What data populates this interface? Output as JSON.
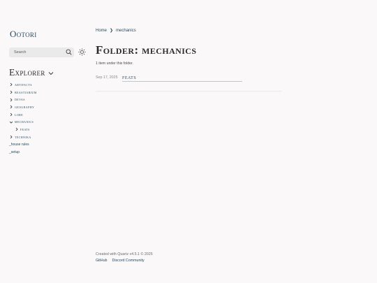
{
  "site": {
    "title": "Ootori"
  },
  "search": {
    "placeholder": "Search"
  },
  "explorer": {
    "title": "Explorer",
    "items": [
      {
        "label": "artifacts",
        "type": "folder",
        "expanded": false
      },
      {
        "label": "beastiarium",
        "type": "folder",
        "expanded": false
      },
      {
        "label": "devas",
        "type": "folder",
        "expanded": false
      },
      {
        "label": "geography",
        "type": "folder",
        "expanded": false
      },
      {
        "label": "lore",
        "type": "folder",
        "expanded": false
      },
      {
        "label": "mechanics",
        "type": "folder",
        "expanded": true
      },
      {
        "label": "feats",
        "type": "folder",
        "expanded": false
      },
      {
        "label": "technika",
        "type": "folder",
        "expanded": false
      },
      {
        "label": "_house rules",
        "type": "file"
      },
      {
        "label": "_setup",
        "type": "file"
      }
    ]
  },
  "breadcrumb": {
    "home": "Home",
    "separator": "❯",
    "current": "mechanics"
  },
  "page": {
    "title": "Folder: mechanics",
    "item_count": "1 item under this folder."
  },
  "listing": [
    {
      "date": "Sep 17, 2025",
      "title": "feats"
    }
  ],
  "footer": {
    "credit": "Created with Quartz v4.5.1 © 2025",
    "links": [
      "GitHub",
      "Discord Community"
    ]
  },
  "colors": {
    "background": "#faf8f8",
    "accent": "#284b63",
    "text": "#2b2b2b",
    "search_bg": "#ebeaea"
  }
}
